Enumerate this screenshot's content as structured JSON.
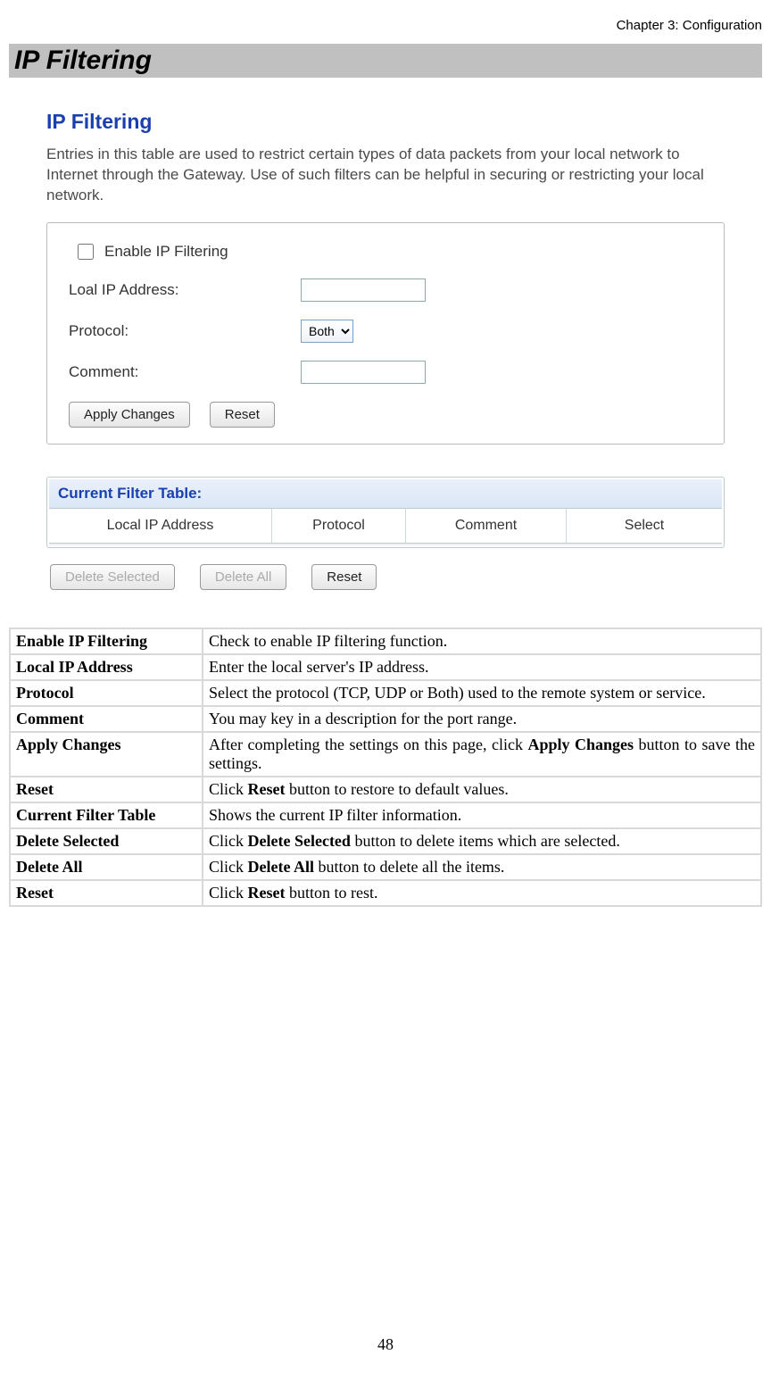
{
  "header": {
    "chapter": "Chapter 3: Configuration"
  },
  "title": "IP Filtering",
  "panel": {
    "title": "IP Filtering",
    "description": "Entries in this table are used to restrict certain types of data packets from your local network to Internet through the Gateway. Use of such filters can be helpful in securing or restricting your local network.",
    "enable_label": "Enable IP Filtering",
    "ip_label": "Loal IP Address:",
    "ip_value": "",
    "protocol_label": "Protocol:",
    "protocol_selected": "Both",
    "comment_label": "Comment:",
    "comment_value": "",
    "btn_apply": "Apply Changes",
    "btn_reset": "Reset",
    "filter_table_title": "Current Filter Table:",
    "filter_cols": {
      "c1": "Local IP Address",
      "c2": "Protocol",
      "c3": "Comment",
      "c4": "Select"
    },
    "btn_delete_selected": "Delete Selected",
    "btn_delete_all": "Delete All",
    "btn_reset2": "Reset"
  },
  "defs": [
    {
      "term": "Enable IP Filtering",
      "def": "Check to enable IP filtering function."
    },
    {
      "term": "Local IP Address",
      "def": "Enter the local server's IP address."
    },
    {
      "term": "Protocol",
      "def": "Select the protocol (TCP, UDP or Both) used to the remote system or service."
    },
    {
      "term": "Comment",
      "def": "You may key in a description for the port range."
    },
    {
      "term": "Apply Changes",
      "def_pre": "After completing the settings on this page, click ",
      "def_bold": "Apply Changes",
      "def_post": " button to save the settings."
    },
    {
      "term": "Reset",
      "def_pre": "Click ",
      "def_bold": "Reset",
      "def_post": " button to restore to default values."
    },
    {
      "term": "Current Filter Table",
      "def": "Shows the current IP filter information."
    },
    {
      "term": "Delete Selected",
      "def_pre": "Click ",
      "def_bold": "Delete Selected",
      "def_post": " button to delete items which are selected."
    },
    {
      "term": "Delete All",
      "def_pre": "Click ",
      "def_bold": "Delete All",
      "def_post": " button to delete all the items."
    },
    {
      "term": "Reset",
      "def_pre": "Click ",
      "def_bold": "Reset",
      "def_post": " button to rest."
    }
  ],
  "page_number": "48"
}
